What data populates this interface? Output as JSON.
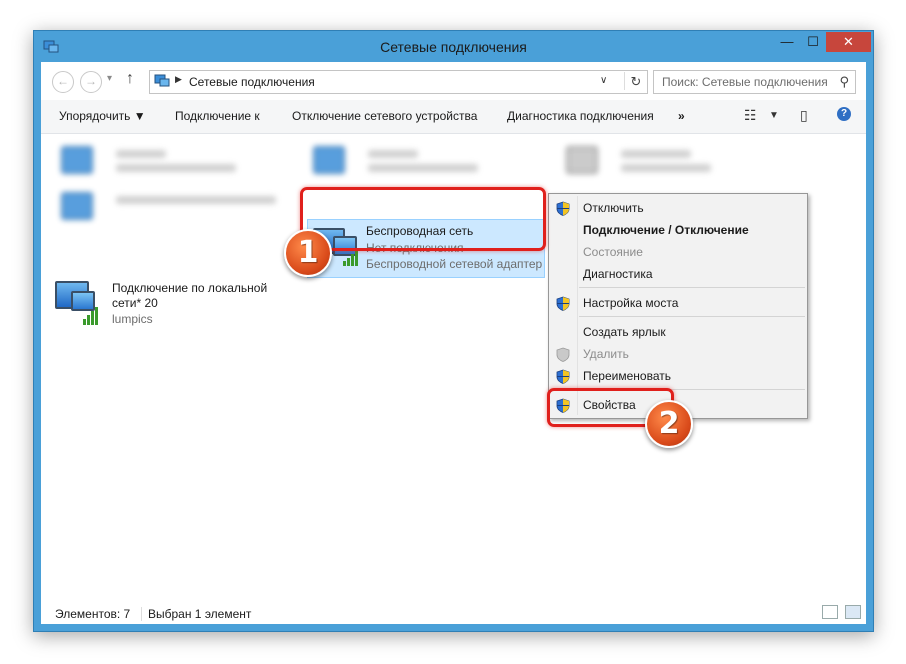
{
  "window": {
    "title": "Сетевые подключения",
    "controls": {
      "minimize": "—",
      "maximize": "☐",
      "close": "✕"
    }
  },
  "address": {
    "path": "Сетевые подключения",
    "search_placeholder": "Поиск: Сетевые подключения"
  },
  "toolbar": {
    "organize": "Упорядочить ▼",
    "connect_to": "Подключение к",
    "disable_device": "Отключение сетевого устройства",
    "diagnose": "Диагностика подключения",
    "more": "»"
  },
  "items": {
    "wireless": {
      "name": "Беспроводная сеть",
      "status": "Нет подключения",
      "adapter": "Беспроводной сетевой адаптер"
    },
    "local": {
      "name_line1": "Подключение по локальной",
      "name_line2": "сети* 20",
      "status": "lumpics"
    }
  },
  "context_menu": {
    "items": [
      {
        "label": "Отключить",
        "shield": true
      },
      {
        "label": "Подключение / Отключение",
        "bold": true
      },
      {
        "label": "Состояние",
        "disabled": true
      },
      {
        "label": "Диагностика"
      },
      {
        "label": "Настройка моста",
        "shield": true
      },
      {
        "label": "Создать ярлык"
      },
      {
        "label": "Удалить",
        "shield": true,
        "disabled": true
      },
      {
        "label": "Переименовать",
        "shield": true
      },
      {
        "label": "Свойства",
        "shield": true
      }
    ]
  },
  "annotations": {
    "badge1": "1",
    "badge2": "2",
    "color": "#e0201c"
  },
  "statusbar": {
    "count": "Элементов: 7",
    "selected": "Выбран 1 элемент"
  }
}
